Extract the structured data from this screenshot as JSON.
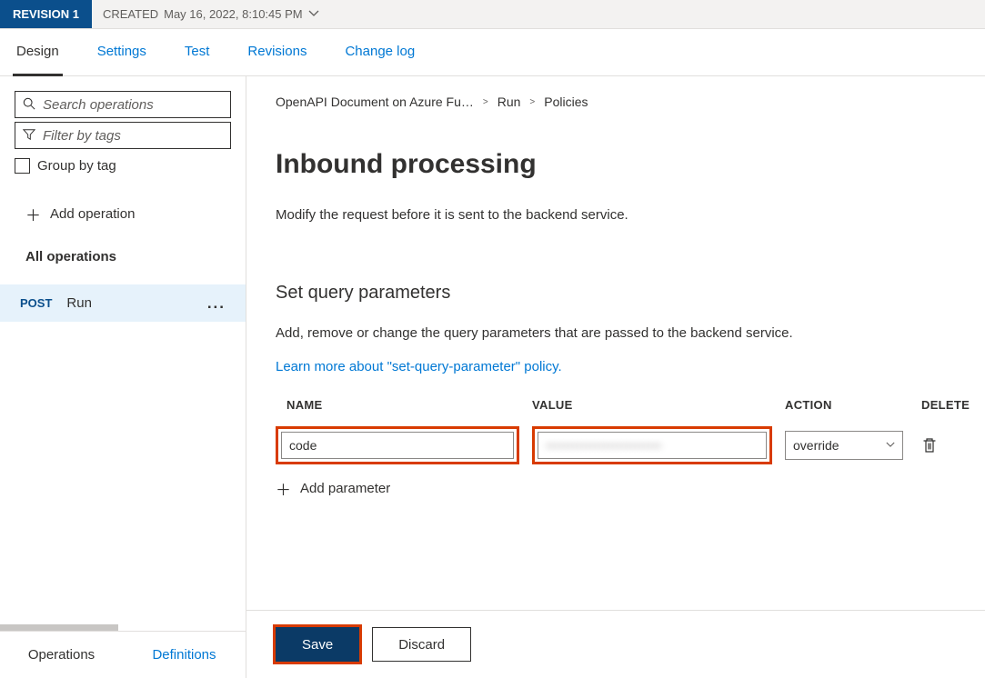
{
  "topbar": {
    "revision_label": "REVISION 1",
    "created_label": "CREATED",
    "created_value": "May 16, 2022, 8:10:45 PM"
  },
  "tabs": {
    "design": "Design",
    "settings": "Settings",
    "test": "Test",
    "revisions": "Revisions",
    "changelog": "Change log"
  },
  "sidebar": {
    "search_placeholder": "Search operations",
    "filter_placeholder": "Filter by tags",
    "group_label": "Group by tag",
    "add_operation": "Add operation",
    "all_operations": "All operations",
    "op_method": "POST",
    "op_name": "Run",
    "bottom": {
      "operations": "Operations",
      "definitions": "Definitions"
    }
  },
  "breadcrumb": {
    "a": "OpenAPI Document on Azure Fu…",
    "b": "Run",
    "c": "Policies"
  },
  "main": {
    "title": "Inbound processing",
    "desc": "Modify the request before it is sent to the backend service.",
    "section": "Set query parameters",
    "section_desc": "Add, remove or change the query parameters that are passed to the backend service.",
    "learn_more": "Learn more about \"set-query-parameter\" policy.",
    "cols": {
      "name": "NAME",
      "value": "VALUE",
      "action": "ACTION",
      "delete": "DELETE"
    },
    "row": {
      "name": "code",
      "value": "••••••••••••••••••••••••••",
      "action": "override"
    },
    "add_parameter": "Add parameter",
    "save": "Save",
    "discard": "Discard"
  }
}
